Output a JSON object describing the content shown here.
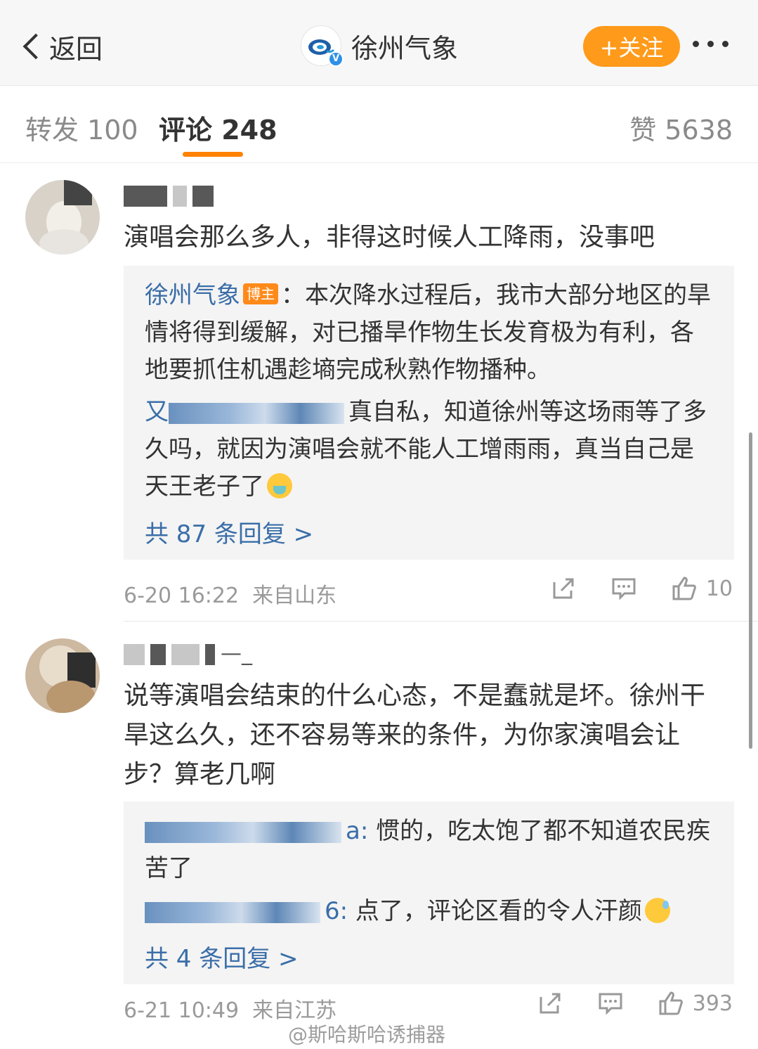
{
  "header": {
    "back_label": "返回",
    "account_name": "徐州气象",
    "follow_label": "+关注",
    "more_icon": "more-dots-icon"
  },
  "tabs": {
    "repost": "转发 100",
    "comment": "评论 248",
    "like": "赞 5638"
  },
  "comments": [
    {
      "text": "演唱会那么多人，非得这时候人工降雨，没事吧",
      "replies": [
        {
          "author": "徐州气象",
          "badge": "博主",
          "text": "：本次降水过程后，我市大部分地区的旱情将得到缓解，对已播旱作物生长发育极为有利，各地要抓住机遇趁墒完成秋熟作物播种。"
        },
        {
          "author_prefix": "又",
          "text": "真自私，知道徐州等这场雨等了多久吗，就因为演唱会就不能人工增雨雨，真当自己是天王老子了"
        }
      ],
      "more_replies": "共 87 条回复 >",
      "time": "6-20 16:22",
      "source": "来自山东",
      "likes": "10"
    },
    {
      "text": "说等演唱会结束的什么心态，不是蠢就是坏。徐州干旱这么久，还不容易等来的条件，为你家演唱会让步？算老几啊",
      "replies": [
        {
          "author_suffix": "a:",
          "text": "惯的，吃太饱了都不知道农民疾苦了"
        },
        {
          "author_suffix": "6:",
          "text": "点了，评论区看的令人汗颜"
        }
      ],
      "more_replies": "共 4 条回复 >",
      "time": "6-21 10:49",
      "source": "来自江苏",
      "likes": "393"
    }
  ],
  "watermark": "@斯哈斯哈诱捕器",
  "colors": {
    "accent": "#ff8200",
    "follow_button": "#ff9a1a",
    "link": "#3a6ea8",
    "badge": "#ff8a1a"
  }
}
